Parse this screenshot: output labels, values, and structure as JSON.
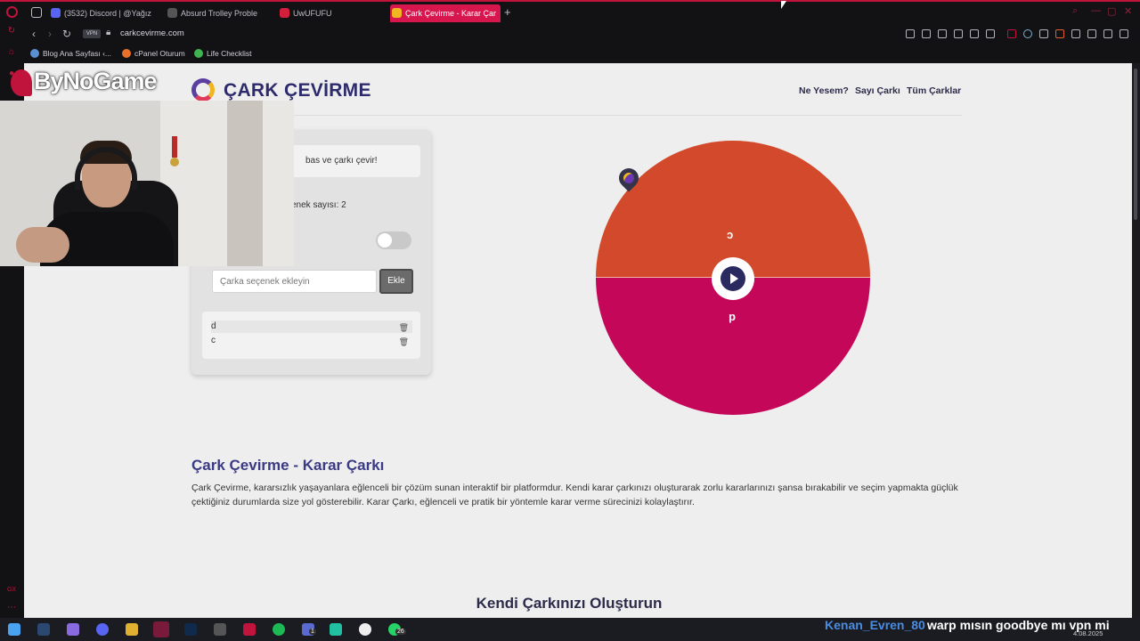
{
  "browser": {
    "tabs": [
      {
        "label": "(3532) Discord | @Yağız"
      },
      {
        "label": "Absurd Trolley Proble"
      },
      {
        "label": "UwUFUFU"
      },
      {
        "label": "Çark Çevirme - Karar Çar"
      }
    ],
    "url": "carkcevirme.com",
    "vpn_label": "VPN",
    "bookmarks": [
      {
        "label": "Blog Ana Sayfası ‹..."
      },
      {
        "label": "cPanel Oturum"
      },
      {
        "label": "Life Checklist"
      }
    ]
  },
  "site": {
    "title": "ÇARK ÇEVİRME",
    "nav": [
      "Ne Yesem?",
      "Sayı Çarkı",
      "Tüm Çarklar"
    ]
  },
  "panel": {
    "instruction": "bas ve çarkı çevir!",
    "option_count": "enek sayısı: 2",
    "input_placeholder": "Çarka seçenek ekleyin",
    "add_button": "Ekle",
    "options": [
      "d",
      "c"
    ]
  },
  "wheel": {
    "segments": [
      {
        "label": "c",
        "color": "#d3492b"
      },
      {
        "label": "d",
        "color": "#c5075a"
      }
    ]
  },
  "content": {
    "heading": "Çark Çevirme - Karar Çarkı",
    "paragraph": "Çark Çevirme, kararsızlık yaşayanlara eğlenceli bir çözüm sunan interaktif bir platformdur. Kendi karar çarkınızı oluşturarak zorlu kararlarınızı şansa bırakabilir ve seçim yapmakta güçlük çektiğiniz durumlarda size yol gösterebilir. Karar Çarkı, eğlenceli ve pratik bir yöntemle karar verme sürecinizi kolaylaştırır.",
    "heading2": "Kendi Çarkınızı Oluşturun"
  },
  "overlay": {
    "brand": "ByNoGame",
    "chat_user": "Kenan_Evren_80",
    "chat_message": "warp mısın goodbye mı vpn mi"
  },
  "taskbar": {
    "badges": [
      "1",
      "26"
    ],
    "date": "4.08.2025"
  }
}
